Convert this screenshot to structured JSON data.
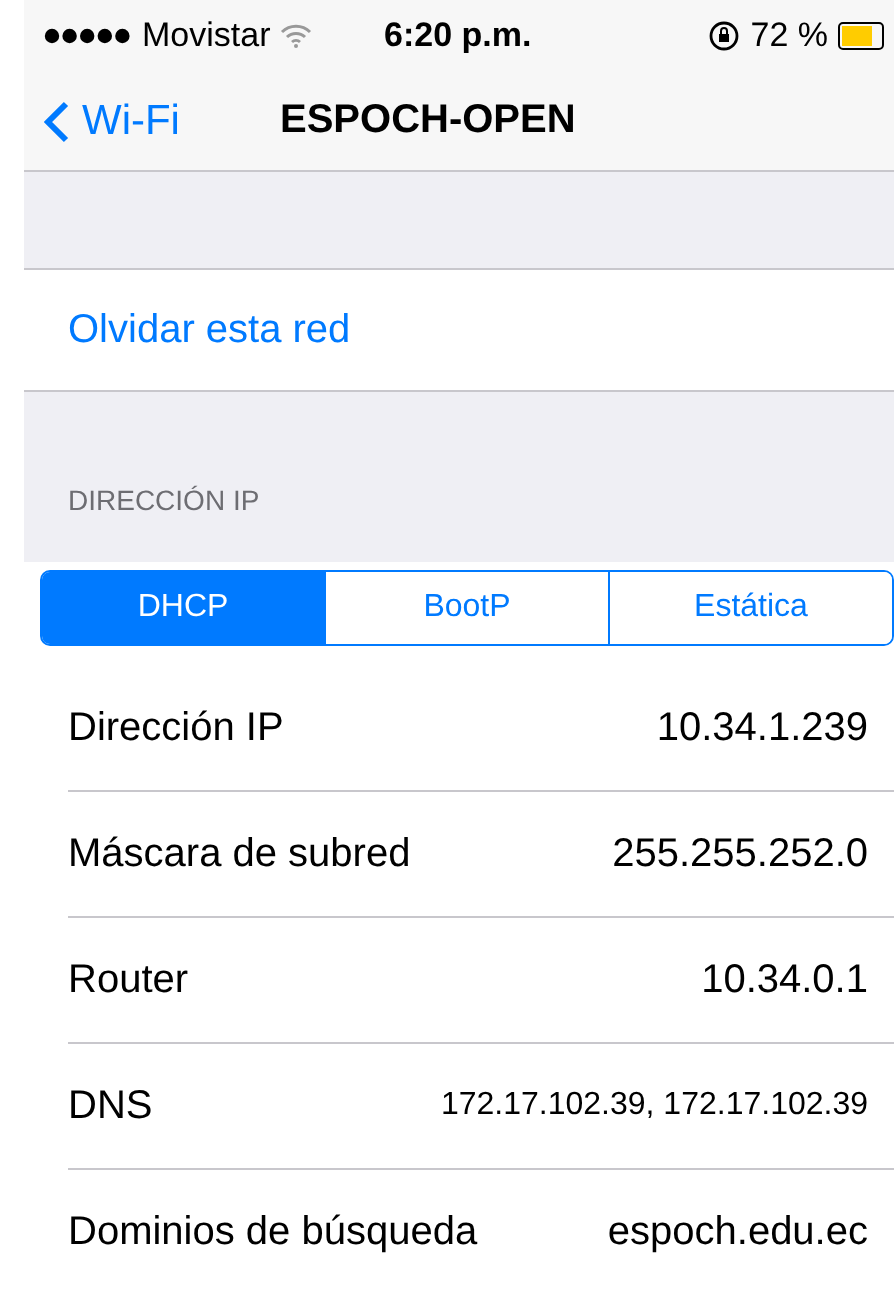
{
  "status_bar": {
    "carrier": "Movistar",
    "time": "6:20 p.m.",
    "battery": "72 %"
  },
  "nav": {
    "back": "Wi-Fi",
    "title": "ESPOCH-OPEN"
  },
  "forget": {
    "label": "Olvidar esta red"
  },
  "ip_section": {
    "header": "DIRECCIÓN IP",
    "tabs": [
      {
        "label": "DHCP",
        "selected": true
      },
      {
        "label": "BootP",
        "selected": false
      },
      {
        "label": "Estática",
        "selected": false
      }
    ],
    "rows": [
      {
        "label": "Dirección IP",
        "value": "10.34.1.239"
      },
      {
        "label": "Máscara de subred",
        "value": "255.255.252.0"
      },
      {
        "label": "Router",
        "value": "10.34.0.1"
      },
      {
        "label": "DNS",
        "value": "172.17.102.39, 172.17.102.39"
      },
      {
        "label": "Dominios de búsqueda",
        "value": "espoch.edu.ec"
      }
    ]
  }
}
